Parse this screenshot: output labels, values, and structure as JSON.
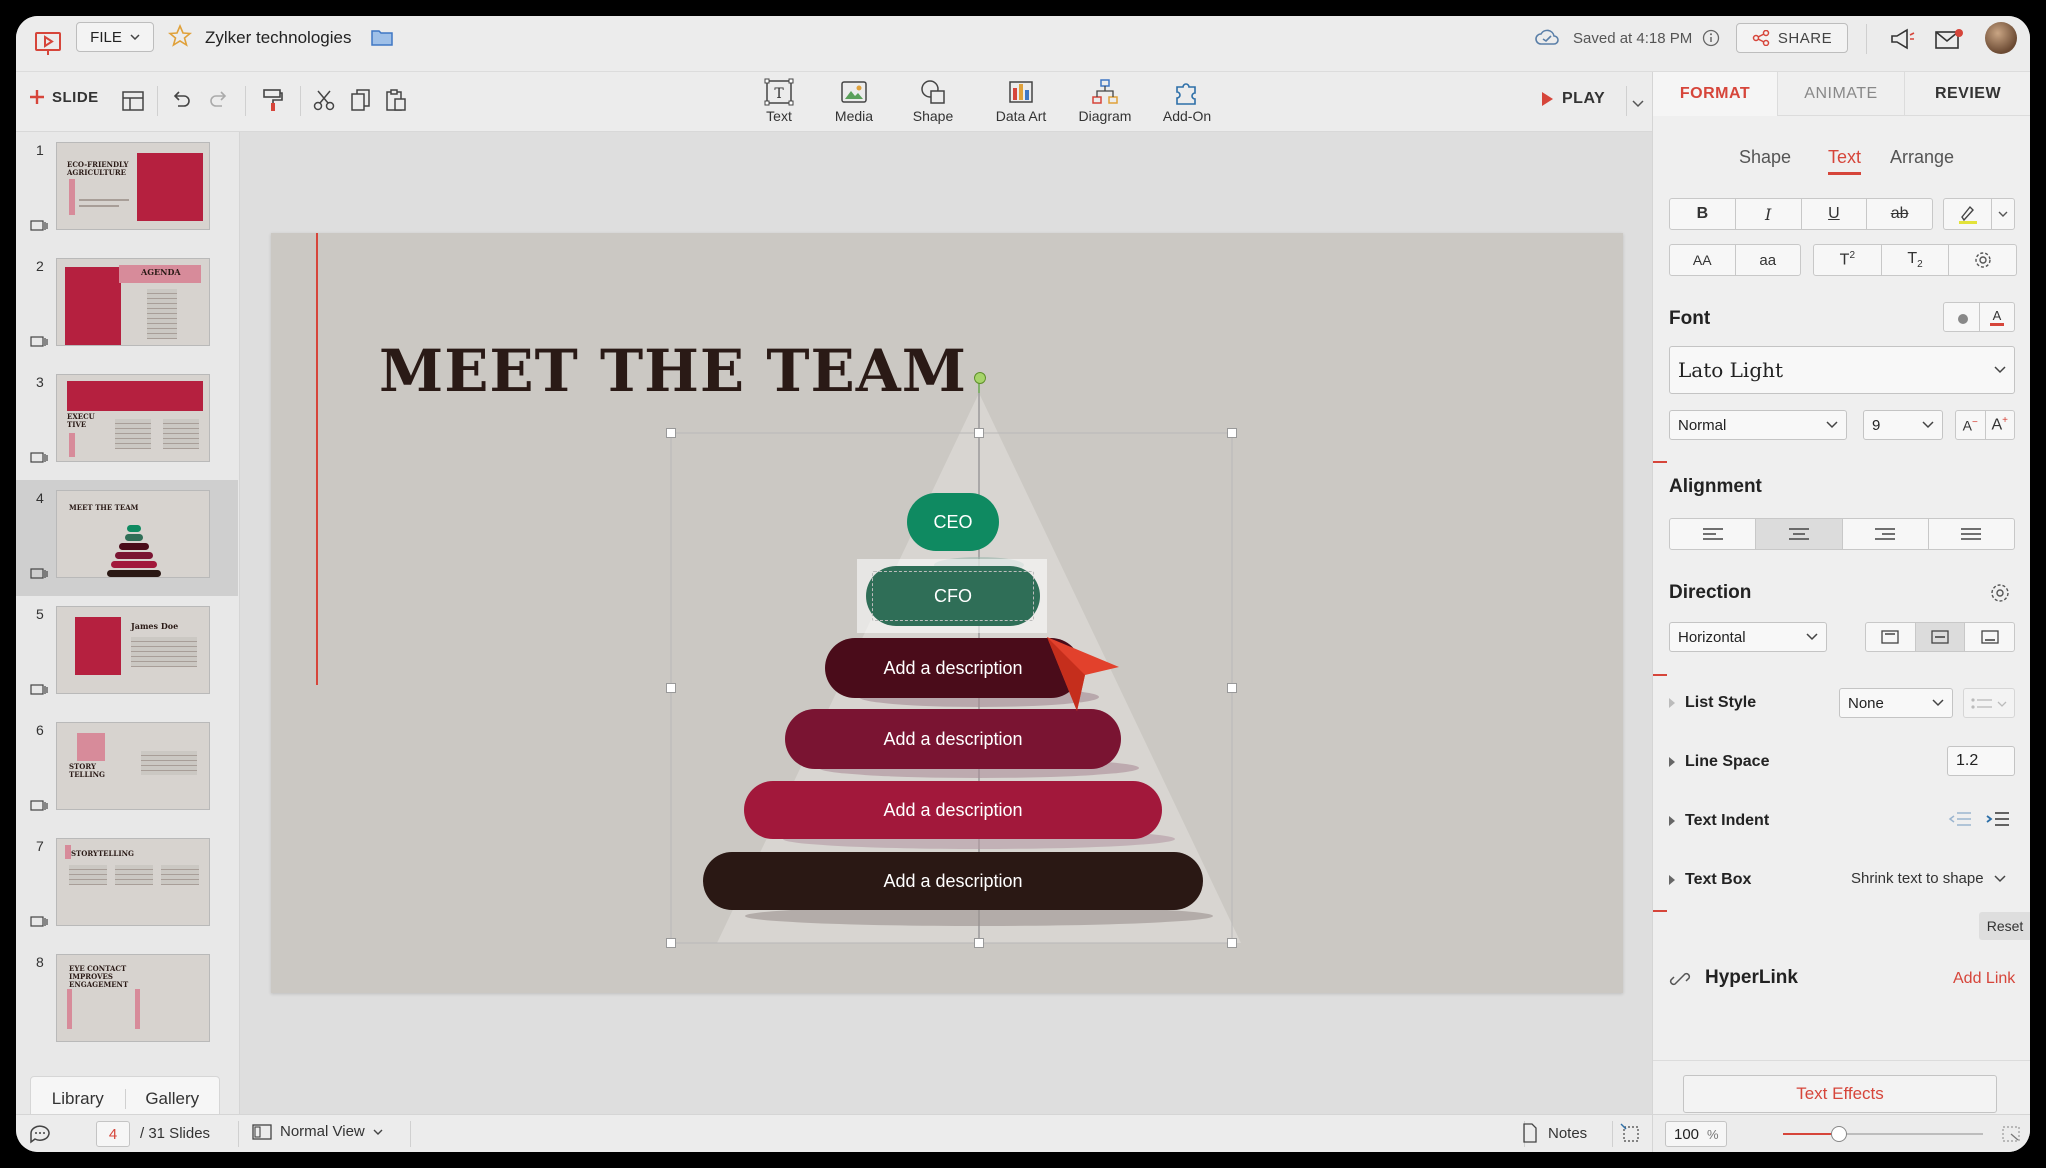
{
  "header": {
    "file_label": "FILE",
    "doc_title": "Zylker technologies",
    "saved_text": "Saved at 4:18 PM",
    "share_label": "SHARE"
  },
  "toolbar": {
    "slide_label": "SLIDE",
    "play_label": "PLAY",
    "insert": [
      {
        "label": "Text",
        "icon": "text-box-icon"
      },
      {
        "label": "Media",
        "icon": "image-icon"
      },
      {
        "label": "Shape",
        "icon": "shape-icon"
      },
      {
        "label": "Data Art",
        "icon": "chart-icon"
      },
      {
        "label": "Diagram",
        "icon": "diagram-icon"
      },
      {
        "label": "Add-On",
        "icon": "puzzle-icon"
      }
    ]
  },
  "slides_panel": {
    "thumbs": [
      {
        "num": "1",
        "title": "ECO-FRIENDLY AGRICULTURE"
      },
      {
        "num": "2",
        "title": "AGENDA"
      },
      {
        "num": "3",
        "title": "EXECU TIVE"
      },
      {
        "num": "4",
        "title": "MEET THE TEAM"
      },
      {
        "num": "5",
        "title": "James Doe"
      },
      {
        "num": "6",
        "title": "STORY TELLING"
      },
      {
        "num": "7",
        "title": "STORYTELLING"
      },
      {
        "num": "8",
        "title": "EYE CONTACT IMPROVES ENGAGEMENT"
      }
    ],
    "library_label": "Library",
    "gallery_label": "Gallery"
  },
  "slide": {
    "title": "MEET THE TEAM",
    "pyramid": {
      "ceo": "CEO",
      "cfo": "CFO",
      "row1": "Add a description",
      "row2": "Add a description",
      "row3": "Add a description",
      "row4": "Add a description"
    }
  },
  "right_panel": {
    "tabs": [
      "FORMAT",
      "ANIMATE",
      "REVIEW"
    ],
    "subtabs": [
      "Shape",
      "Text",
      "Arrange"
    ],
    "font_title": "Font",
    "font_name": "Lato Light",
    "font_style": "Normal",
    "font_size": "9",
    "alignment_title": "Alignment",
    "direction_title": "Direction",
    "direction_value": "Horizontal",
    "list_style_label": "List Style",
    "list_style_value": "None",
    "line_space_label": "Line Space",
    "line_space_value": "1.2",
    "text_indent_label": "Text Indent",
    "text_box_label": "Text Box",
    "text_box_value": "Shrink text to shape",
    "reset_label": "Reset",
    "hyperlink_label": "HyperLink",
    "add_link_label": "Add Link",
    "text_effects_label": "Text Effects"
  },
  "status": {
    "current_slide": "4",
    "total_slides": "/ 31 Slides",
    "view_label": "Normal View",
    "notes_label": "Notes",
    "zoom": "100",
    "zoom_unit": "%"
  },
  "colors": {
    "accent": "#d6453a",
    "ceo_green": "#0f8a61",
    "cfo_green": "#2f6e57",
    "maroon_dark": "#4a0c1a",
    "maroon": "#7a1432",
    "crimson": "#a2183b",
    "brown_dark": "#2a1814"
  }
}
